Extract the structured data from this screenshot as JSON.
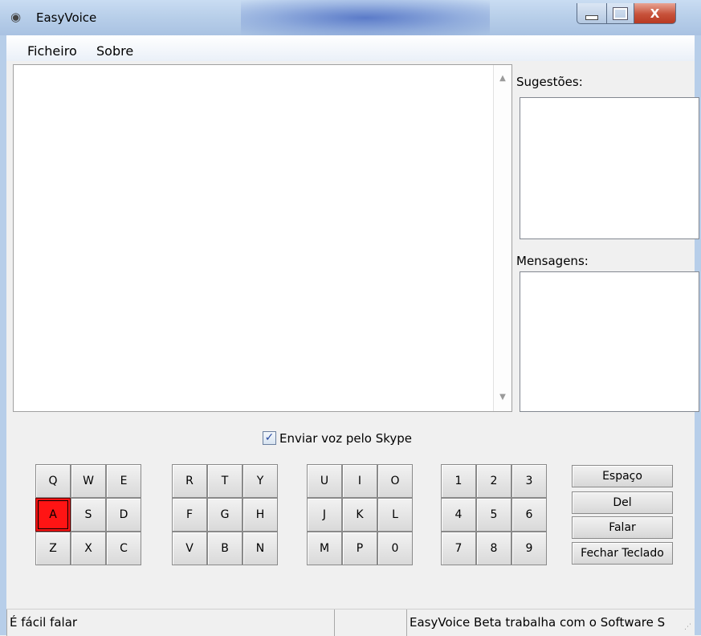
{
  "window": {
    "title": "EasyVoice",
    "icon": "app-speaker-icon",
    "close_glyph": "X"
  },
  "menu": [
    {
      "label": "Ficheiro"
    },
    {
      "label": "Sobre"
    }
  ],
  "panels": {
    "suggestions_label": "Sugestões:",
    "messages_label": "Mensagens:"
  },
  "options": {
    "skype_label": "Enviar voz pelo Skype",
    "skype_checked": true,
    "check_glyph": "✓"
  },
  "scroll": {
    "up": "▲",
    "down": "▼"
  },
  "keyboard": {
    "groups": [
      [
        [
          "Q",
          "W",
          "E"
        ],
        [
          "A",
          "S",
          "D"
        ],
        [
          "Z",
          "X",
          "C"
        ]
      ],
      [
        [
          "R",
          "T",
          "Y"
        ],
        [
          "F",
          "G",
          "H"
        ],
        [
          "V",
          "B",
          "N"
        ]
      ],
      [
        [
          "U",
          "I",
          "O"
        ],
        [
          "J",
          "K",
          "L"
        ],
        [
          "M",
          "P",
          "0"
        ]
      ],
      [
        [
          "1",
          "2",
          "3"
        ],
        [
          "4",
          "5",
          "6"
        ],
        [
          "7",
          "8",
          "9"
        ]
      ]
    ],
    "active_key": "A",
    "actions": [
      "Espaço",
      "Del",
      "Falar",
      "Fechar Teclado"
    ]
  },
  "status": {
    "left": "É fácil falar",
    "middle": "",
    "right": "EasyVoice Beta trabalha com o Software S"
  },
  "colors": {
    "active_key": "#ff1414",
    "titlebar": "#b7cee9"
  }
}
